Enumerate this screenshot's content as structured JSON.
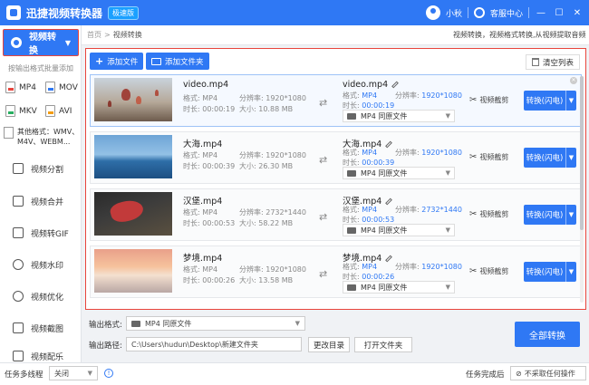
{
  "app": {
    "title": "迅捷视频转换器",
    "badge": "极速版",
    "user": "小秋",
    "service": "客服中心",
    "min": "—",
    "max": "☐",
    "close": "✕"
  },
  "sidebar": {
    "main": "视频转换",
    "formats_head": "按输出格式批量添加",
    "formats": [
      "MP4",
      "MOV",
      "MKV",
      "AVI"
    ],
    "other_label": "其他格式：WMV、M4V、WEBM...",
    "other_line1": "其他格式：WMV、",
    "other_line2": "M4V、WEBM...",
    "items": [
      "视频分割",
      "视频合并",
      "视频转GIF",
      "视频水印",
      "视频优化",
      "视频截图",
      "视频配乐"
    ]
  },
  "breadcrumb": {
    "home": "首页",
    "sep": ">",
    "current": "视频转换",
    "hint": "视频转换，视频格式转换,从视频提取音频"
  },
  "toolbar": {
    "add_file": "添加文件",
    "add_folder": "添加文件夹",
    "clear": "清空列表"
  },
  "labels": {
    "format": "格式:",
    "resolution": "分辨率:",
    "duration": "时长:",
    "size": "大小:",
    "out_format_sel": "MP4  同原文件",
    "cut": "视频截剪",
    "convert": "转换(闪电)"
  },
  "files": [
    {
      "name": "video.mp4",
      "format": "MP4",
      "resolution": "1920*1080",
      "duration": "00:00:19",
      "size": "10.88 MB",
      "out_name": "video.mp4",
      "out_format": "MP4",
      "out_resolution": "1920*1080",
      "out_duration": "00:00:19"
    },
    {
      "name": "大海.mp4",
      "format": "MP4",
      "resolution": "1920*1080",
      "duration": "00:00:39",
      "size": "26.30 MB",
      "out_name": "大海.mp4",
      "out_format": "MP4",
      "out_resolution": "1920*1080",
      "out_duration": "00:00:39"
    },
    {
      "name": "汉堡.mp4",
      "format": "MP4",
      "resolution": "2732*1440",
      "duration": "00:00:53",
      "size": "58.22 MB",
      "out_name": "汉堡.mp4",
      "out_format": "MP4",
      "out_resolution": "2732*1440",
      "out_duration": "00:00:53"
    },
    {
      "name": "梦境.mp4",
      "format": "MP4",
      "resolution": "1920*1080",
      "duration": "00:00:26",
      "size": "13.58 MB",
      "out_name": "梦境.mp4",
      "out_format": "MP4",
      "out_resolution": "1920*1080",
      "out_duration": "00:00:26"
    }
  ],
  "bottom": {
    "output_format_label": "输出格式:",
    "output_format_value": "MP4  同原文件",
    "output_path_label": "输出路径:",
    "output_path_value": "C:\\Users\\hudun\\Desktop\\新建文件夹",
    "change_dir": "更改目录",
    "open_folder": "打开文件夹",
    "convert_all": "全部转换"
  },
  "status": {
    "multi_label": "任务多线程",
    "multi_value": "关闭",
    "after_label": "任务完成后",
    "after_value": "不采取任何操作"
  },
  "colors": {
    "accent": "#2f78f4",
    "highlight": "#e8453c"
  }
}
